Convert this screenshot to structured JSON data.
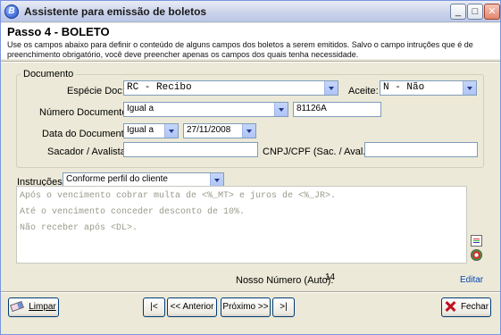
{
  "window": {
    "title": "Assistente para emissão de boletos",
    "icon_letter": "B",
    "controls": {
      "minimize": "_",
      "maximize": "□",
      "close": "✕"
    }
  },
  "header": {
    "step_title": "Passo 4 - BOLETO",
    "help_text": "Use os campos abaixo para definir o conteúdo de alguns campos dos boletos a serem emitidos. Salvo o campo intruções que é de preenchimento obrigatório, você deve preencher apenas os campos dos quais tenha necessidade."
  },
  "documento": {
    "group_label": "Documento",
    "especie_label": "Espécie Doc:",
    "especie_value": "RC  - Recibo",
    "aceite_label": "Aceite:",
    "aceite_value": "N - Não",
    "numero_label": "Número Documento:",
    "numero_operator": "Igual a",
    "numero_value": "81126A",
    "data_label": "Data do Documento:",
    "data_operator": "Igual a",
    "data_value": "27/11/2008",
    "sacador_label": "Sacador / Avalista:",
    "sacador_value": "",
    "cnpj_label": "CNPJ/CPF (Sac. / Aval.):",
    "cnpj_value": ""
  },
  "instrucoes": {
    "label": "Instruções:",
    "profile_value": "Conforme perfil do cliente",
    "lines": [
      "Após o vencimento cobrar multa de <%_MT> e juros de <%_JR>.",
      "Até o vencimento conceder desconto de 10%.",
      "Não receber após <DL>."
    ]
  },
  "nosso_numero": {
    "label": "Nosso Número (Auto):",
    "value": "14",
    "edit_link": "Editar"
  },
  "footer": {
    "limpar": "Limpar",
    "first": "|<",
    "anterior": "<< Anterior",
    "proximo": "Próximo >>",
    "last": ">|",
    "fechar": "Fechar"
  }
}
